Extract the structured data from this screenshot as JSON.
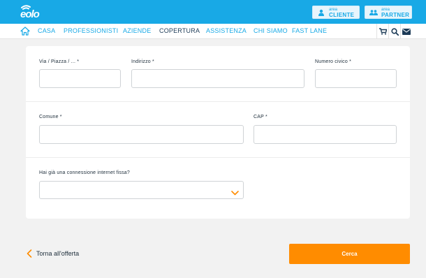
{
  "brand": {
    "logo_text": "eolo",
    "accent": "#18a9e6",
    "cta": "#ff8c00"
  },
  "header": {
    "area_cliente": {
      "small": "area",
      "big": "CLIENTE",
      "icon": "user-icon"
    },
    "area_partner": {
      "small": "area",
      "big": "PARTNER",
      "icon": "users-icon"
    }
  },
  "nav": {
    "home_icon": "home-icon",
    "items": [
      {
        "label": "CASA"
      },
      {
        "label": "PROFESSIONISTI"
      },
      {
        "label": "AZIENDE"
      },
      {
        "label": "COPERTURA"
      },
      {
        "label": "ASSISTENZA"
      },
      {
        "label": "CHI SIAMO"
      },
      {
        "label": "FAST LANE"
      }
    ],
    "active": "COPERTURA",
    "icons": [
      "cart-icon",
      "search-icon",
      "mail-icon"
    ]
  },
  "form": {
    "via": {
      "label": "Via / Piazza / ... *",
      "value": ""
    },
    "indirizzo": {
      "label": "Indirizzo *",
      "value": ""
    },
    "numero": {
      "label": "Numero civico *",
      "value": ""
    },
    "comune": {
      "label": "Comune *",
      "value": ""
    },
    "cap": {
      "label": "CAP *",
      "value": ""
    },
    "connessione": {
      "label": "Hai già una connessione internet fissa?",
      "value": ""
    }
  },
  "footer": {
    "back_label": "Torna all'offerta",
    "submit_label": "Cerca"
  }
}
